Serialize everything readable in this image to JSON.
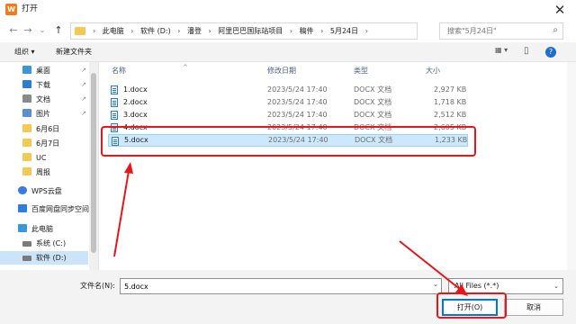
{
  "window": {
    "title": "打开",
    "app_logo": "W",
    "close_glyph": "✕"
  },
  "nav": {
    "back": "←",
    "forward": "→",
    "dropdown": "⌄",
    "up": "↑"
  },
  "address": {
    "crumbs": [
      "此电脑",
      "软件 (D:)",
      "潘登",
      "阿里巴巴国际站项目",
      "稿件",
      "5月24日"
    ],
    "separator": "›",
    "dropdown": "⌄",
    "refresh": "↻"
  },
  "search": {
    "placeholder": "搜索\"5月24日\"",
    "icon": "search-icon"
  },
  "toolbar": {
    "organize": "组织 ▾",
    "new_folder": "新建文件夹",
    "view_icon": "▦ ▾",
    "pane_icon": "▯",
    "help_icon": "?"
  },
  "sidebar": {
    "items": [
      {
        "label": "桌面",
        "icon": "desktop-icon",
        "color": "#3a96dd",
        "pinned": true
      },
      {
        "label": "下载",
        "icon": "download-icon",
        "color": "#2b7cd3",
        "pinned": true
      },
      {
        "label": "文档",
        "icon": "document-icon",
        "color": "#8a8a8a",
        "pinned": true
      },
      {
        "label": "图片",
        "icon": "picture-icon",
        "color": "#5a8fd6",
        "pinned": true
      },
      {
        "label": "6月6日",
        "icon": "folder-icon",
        "color": "#f6c955",
        "pinned": false
      },
      {
        "label": "6月7日",
        "icon": "folder-icon",
        "color": "#f6c955",
        "pinned": false
      },
      {
        "label": "UC",
        "icon": "folder-icon",
        "color": "#f6c955",
        "pinned": false
      },
      {
        "label": "周报",
        "icon": "folder-icon",
        "color": "#f6c955",
        "pinned": false
      },
      {
        "label": "WPS云盘",
        "icon": "cloud-icon",
        "color": "#3a7be0",
        "pinned": false
      },
      {
        "label": "百度网盘同步空间",
        "icon": "baidu-cloud-icon",
        "color": "#2f7de1",
        "pinned": false
      },
      {
        "label": "此电脑",
        "icon": "computer-icon",
        "color": "#3a96dd",
        "pinned": false
      },
      {
        "label": "系统 (C:)",
        "icon": "drive-icon",
        "color": "#7a7a7a",
        "pinned": false
      },
      {
        "label": "软件 (D:)",
        "icon": "drive-icon",
        "color": "#7a7a7a",
        "pinned": false
      }
    ],
    "selected_index": 12,
    "pin_glyph": "📌"
  },
  "columns": {
    "name": "名称",
    "date": "修改日期",
    "type": "类型",
    "size": "大小",
    "sort_glyph": "^"
  },
  "files": [
    {
      "name": "1.docx",
      "date": "2023/5/24 17:40",
      "type": "DOCX 文档",
      "size": "2,927 KB"
    },
    {
      "name": "2.docx",
      "date": "2023/5/24 17:40",
      "type": "DOCX 文档",
      "size": "1,718 KB"
    },
    {
      "name": "3.docx",
      "date": "2023/5/24 17:40",
      "type": "DOCX 文档",
      "size": "2,512 KB"
    },
    {
      "name": "4.docx",
      "date": "2023/5/24 17:40",
      "type": "DOCX 文档",
      "size": "2,605 KB"
    },
    {
      "name": "5.docx",
      "date": "2023/5/24 17:40",
      "type": "DOCX 文档",
      "size": "1,233 KB"
    }
  ],
  "selected_file_index": 4,
  "bottom": {
    "filename_label": "文件名(N):",
    "filename_value": "5.docx",
    "filetype": "All Files (*.*)",
    "open_button": "打开(O)",
    "cancel_button": "取消"
  },
  "annotation_color": "#e8151b"
}
